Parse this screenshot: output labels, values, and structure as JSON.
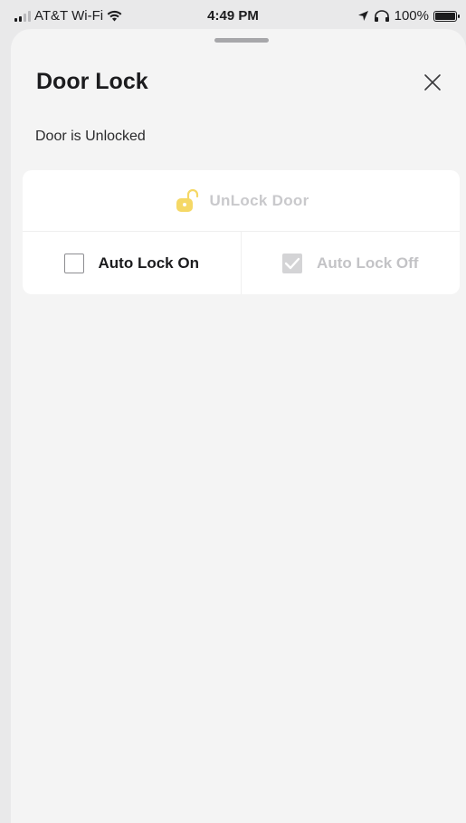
{
  "status_bar": {
    "carrier": "AT&T Wi-Fi",
    "time": "4:49 PM",
    "battery": "100%",
    "battery_level": 1.0
  },
  "sheet": {
    "title": "Door Lock",
    "close_icon": "close-icon",
    "status_text": "Door is Unlocked"
  },
  "controls": {
    "unlock_label": "UnLock Door",
    "unlock_icon": "unlocked-padlock-icon",
    "unlock_icon_color": "#f5d866",
    "auto_lock_on": {
      "label": "Auto Lock On",
      "checked": false
    },
    "auto_lock_off": {
      "label": "Auto Lock Off",
      "checked": true
    }
  },
  "colors": {
    "sheet_background": "#f4f4f4",
    "card_background": "#ffffff",
    "disabled_text": "#c9c9cc"
  }
}
